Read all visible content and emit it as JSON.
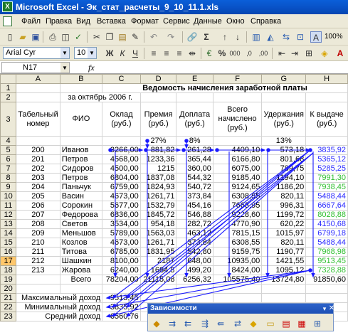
{
  "window": {
    "title": "Microsoft Excel - Эк_стат_расчеты_9_10_11.1.xls",
    "app_icon": "excel-icon"
  },
  "menu": [
    "Файл",
    "Правка",
    "Вид",
    "Вставка",
    "Формат",
    "Сервис",
    "Данные",
    "Окно",
    "Справка"
  ],
  "toolbar": {
    "zoom": "100%",
    "font": "Arial Cyr",
    "size": "10"
  },
  "formula_bar": {
    "name_box": "N17",
    "fx": "fx",
    "value": ""
  },
  "columns": [
    "A",
    "B",
    "C",
    "D",
    "E",
    "F",
    "G",
    "H"
  ],
  "rows": [
    {
      "n": "1",
      "cells": [
        "",
        "",
        "Ведомость начисления заработной платы",
        "",
        "",
        "",
        "",
        ""
      ]
    },
    {
      "n": "2",
      "cells": [
        "",
        "за октябрь 2006 г.",
        "",
        "",
        "",
        "",
        "",
        ""
      ]
    },
    {
      "n": "3",
      "cells": [
        "Табельный номер",
        "ФИО",
        "Оклад (руб.)",
        "Премия (руб.)",
        "Доплата (руб.)",
        "Всего начислено (руб.)",
        "Удержания (руб.)",
        "К выдаче (руб.)"
      ]
    },
    {
      "n": "4",
      "cells": [
        "",
        "",
        "",
        "27%",
        "8%",
        "",
        "13%",
        ""
      ]
    },
    {
      "n": "5",
      "cells": [
        "200",
        "Иванов",
        "3266,00",
        "881,82",
        "261,28",
        "4409,10",
        "573,18",
        "3835,92"
      ]
    },
    {
      "n": "6",
      "cells": [
        "201",
        "Петров",
        "4568,00",
        "1233,36",
        "365,44",
        "6166,80",
        "801,68",
        "5365,12"
      ]
    },
    {
      "n": "7",
      "cells": [
        "202",
        "Сидоров",
        "4500,00",
        "1215",
        "360,00",
        "6075,00",
        "789,75",
        "5285,25"
      ]
    },
    {
      "n": "8",
      "cells": [
        "203",
        "Петров",
        "6804,00",
        "1837,08",
        "544,32",
        "9185,40",
        "1194,10",
        "7991,30"
      ]
    },
    {
      "n": "9",
      "cells": [
        "204",
        "Паньчук",
        "6759,00",
        "1824,93",
        "540,72",
        "9124,65",
        "1186,20",
        "7938,45"
      ]
    },
    {
      "n": "10",
      "cells": [
        "205",
        "Васин",
        "4673,00",
        "1261,71",
        "373,84",
        "6308,55",
        "820,11",
        "5488,44"
      ]
    },
    {
      "n": "11",
      "cells": [
        "206",
        "Сорокин",
        "5677,00",
        "1532,79",
        "454,16",
        "7663,95",
        "996,31",
        "6667,64"
      ]
    },
    {
      "n": "12",
      "cells": [
        "207",
        "Федорова",
        "6836,00",
        "1845,72",
        "546,88",
        "9228,60",
        "1199,72",
        "8028,88"
      ]
    },
    {
      "n": "13",
      "cells": [
        "208",
        "Светов",
        "3534,00",
        "954,18",
        "282,72",
        "4770,90",
        "620,22",
        "4150,68"
      ]
    },
    {
      "n": "14",
      "cells": [
        "209",
        "Меньшов",
        "5789,00",
        "1563,03",
        "463,12",
        "7815,15",
        "1015,97",
        "6799,18"
      ]
    },
    {
      "n": "15",
      "cells": [
        "210",
        "Козлов",
        "4673,00",
        "1261,71",
        "373,84",
        "6308,55",
        "820,11",
        "5488,44"
      ]
    },
    {
      "n": "16",
      "cells": [
        "211",
        "Титова",
        "6785,00",
        "1831,95",
        "542,80",
        "9159,75",
        "1190,77",
        "7968,98"
      ]
    },
    {
      "n": "17",
      "cells": [
        "212",
        "Шашкин",
        "8100,00",
        "2187",
        "648,00",
        "10935,00",
        "1421,55",
        "9513,45"
      ]
    },
    {
      "n": "18",
      "cells": [
        "213",
        "Жарова",
        "6240,00",
        "1684,8",
        "499,20",
        "8424,00",
        "1095,12",
        "7328,88"
      ]
    },
    {
      "n": "19",
      "cells": [
        "",
        "Всего",
        "78204,00",
        "21115,08",
        "6256,32",
        "105575,40",
        "13724,80",
        "91850,60"
      ]
    },
    {
      "n": "20",
      "cells": [
        "",
        "",
        "",
        "",
        "",
        "",
        "",
        ""
      ]
    },
    {
      "n": "21",
      "cells": [
        "Максимальный доход",
        "",
        "9513,45",
        "",
        "",
        "",
        "",
        ""
      ]
    },
    {
      "n": "22",
      "cells": [
        "Минимальный доход",
        "",
        "3835,92",
        "",
        "",
        "",
        "",
        ""
      ]
    },
    {
      "n": "23",
      "cells": [
        "Средний доход",
        "",
        "6560,76",
        "",
        "",
        "",
        "",
        ""
      ]
    }
  ],
  "dependencies_toolbar": {
    "title": "Зависимости"
  },
  "colors": {
    "title_bar": "#0850c4",
    "arrow": "#1a1aff",
    "selected_header": "#ffc76b",
    "green_text": "#2fbf2f",
    "blue_text": "#2a2aff"
  }
}
